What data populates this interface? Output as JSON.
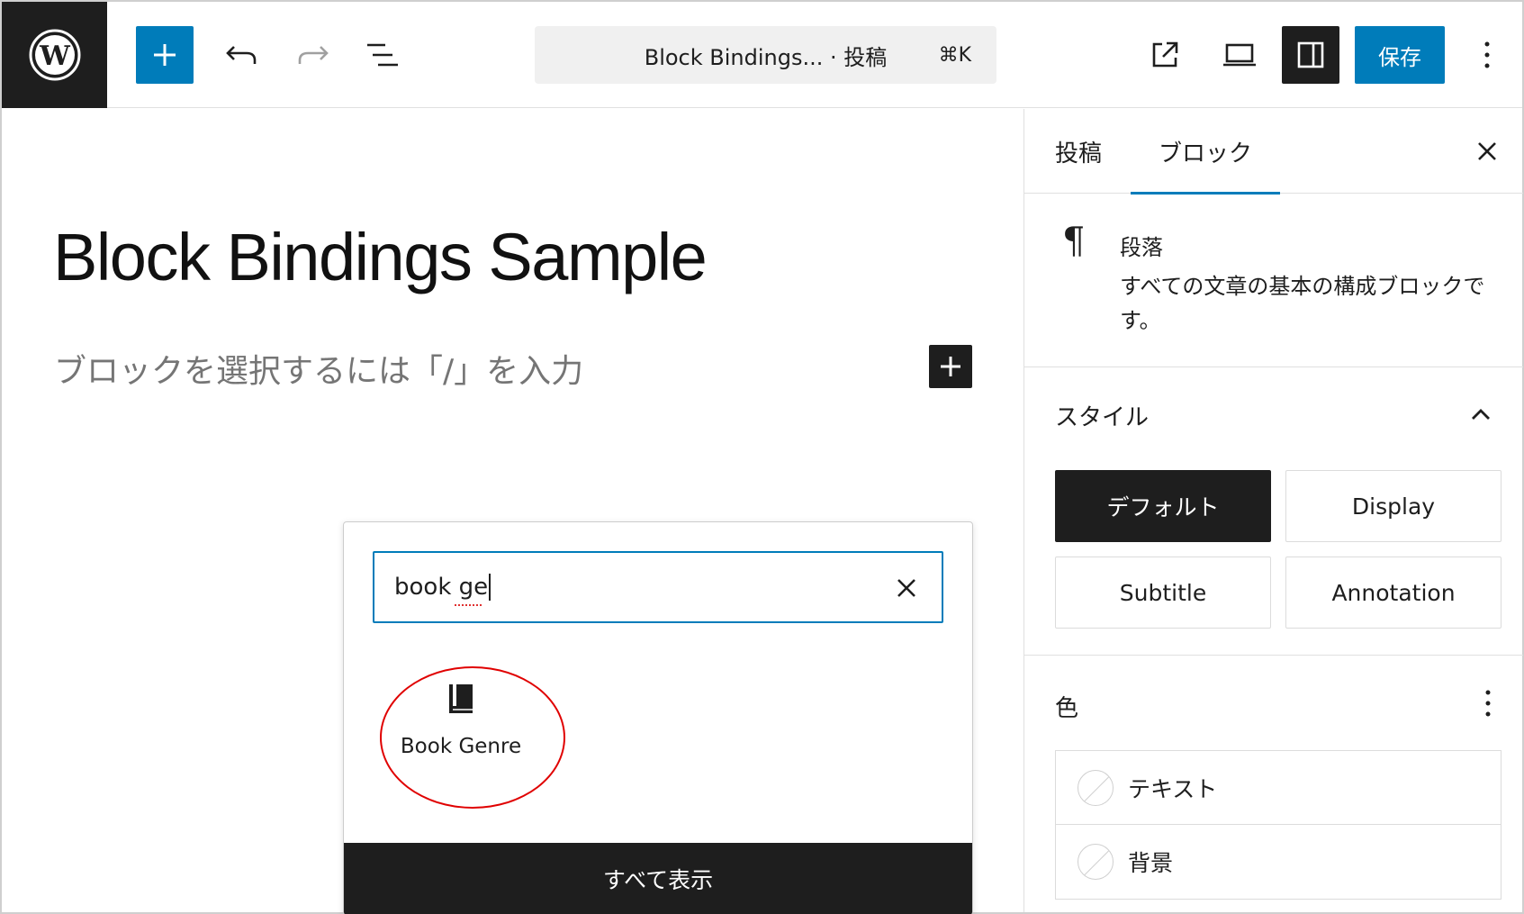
{
  "topbar": {
    "logo_name": "wordpress-logo",
    "document_title": "Block Bindings... · 投稿",
    "command_shortcut": "⌘K",
    "save_label": "保存"
  },
  "editor": {
    "post_title": "Block Bindings Sample",
    "paragraph_placeholder": "ブロックを選択するには「/」を入力"
  },
  "inserter": {
    "search_value": "book ge",
    "results": [
      {
        "label": "Book Genre",
        "icon": "book-icon"
      }
    ],
    "browse_all_label": "すべて表示"
  },
  "sidebar": {
    "tabs": [
      {
        "label": "投稿"
      },
      {
        "label": "ブロック",
        "active": true
      }
    ],
    "block_card": {
      "icon": "paragraph-icon",
      "name": "段落",
      "description": "すべての文章の基本の構成ブロックです。"
    },
    "styles": {
      "title": "スタイル",
      "options": [
        {
          "label": "デフォルト",
          "active": true
        },
        {
          "label": "Display"
        },
        {
          "label": "Subtitle"
        },
        {
          "label": "Annotation"
        }
      ]
    },
    "color": {
      "title": "色",
      "items": [
        {
          "label": "テキスト"
        },
        {
          "label": "背景"
        }
      ]
    }
  },
  "colors": {
    "accent": "#007cba",
    "dark": "#1e1e1e",
    "annotation_circle": "#e00000"
  }
}
